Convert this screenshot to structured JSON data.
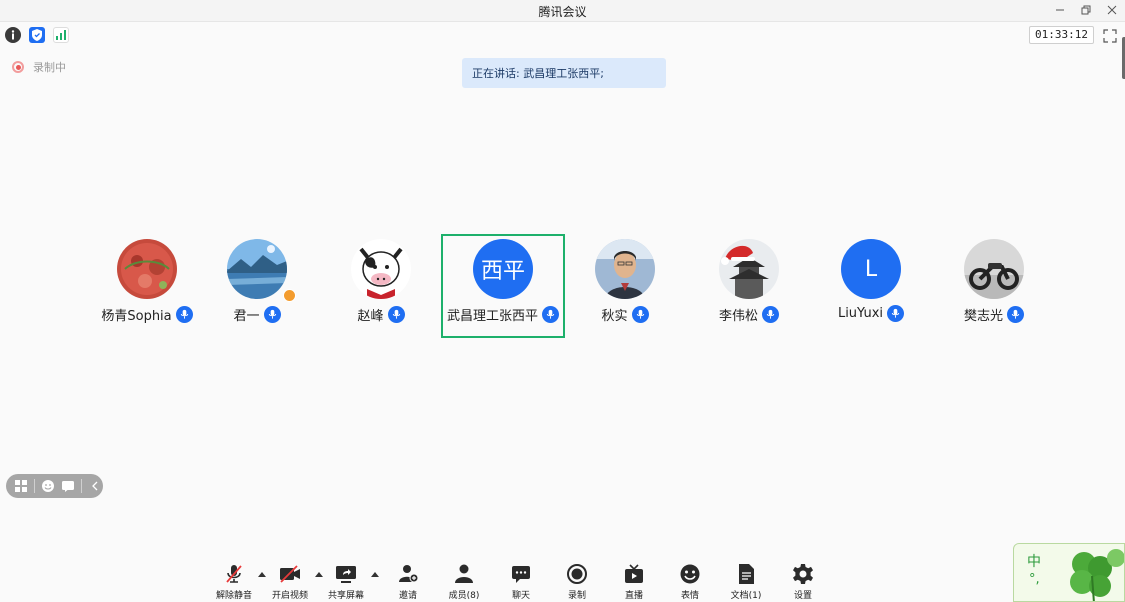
{
  "window": {
    "title": "腾讯会议",
    "minimize_icon": "minimize-icon",
    "restore_icon": "restore-icon",
    "close_icon": "close-icon"
  },
  "status": {
    "icons": [
      "info-icon",
      "shield-icon",
      "signal-icon"
    ],
    "timer": "01:33:12",
    "fullscreen_icon": "fullscreen-icon"
  },
  "recording": {
    "label": "录制中"
  },
  "speaking": {
    "text": "正在讲话: 武昌理工张西平;"
  },
  "participants": [
    {
      "name": "杨青Sophia",
      "avatar": "red-pattern-photo"
    },
    {
      "name": "君一",
      "avatar": "lake-mountain-photo"
    },
    {
      "name": "赵峰",
      "avatar": "cow-cartoon"
    },
    {
      "name": "武昌理工张西平",
      "avatar_text": "西平",
      "active": true
    },
    {
      "name": "秋实",
      "avatar": "man-portrait-photo"
    },
    {
      "name": "李伟松",
      "avatar": "pagoda-santa-hat"
    },
    {
      "name": "LiuYuxi",
      "avatar_text": "L"
    },
    {
      "name": "樊志光",
      "avatar": "motorcycle-photo"
    }
  ],
  "toolbar": {
    "unmute": "解除静音",
    "start_video": "开启视频",
    "share_screen": "共享屏幕",
    "invite": "邀请",
    "members": "成员(8)",
    "chat": "聊天",
    "record": "录制",
    "live": "直播",
    "emoji": "表情",
    "docs": "文档(1)",
    "settings": "设置"
  },
  "ime": {
    "mode": "中",
    "punct": "°,"
  },
  "colors": {
    "accent": "#1f6ef2",
    "active_border": "#1db06b",
    "recording": "#e85858"
  }
}
